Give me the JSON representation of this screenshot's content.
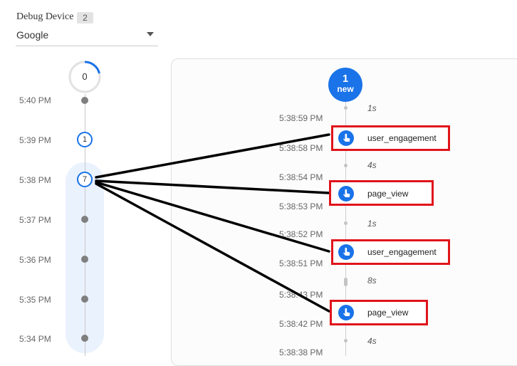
{
  "device": {
    "title": "Debug Device",
    "count": "2",
    "selected": "Google"
  },
  "minutes": {
    "counter": "0",
    "items": [
      {
        "time": "5:40 PM"
      },
      {
        "time": "5:39 PM",
        "count": "1"
      },
      {
        "time": "5:38 PM",
        "count": "7"
      },
      {
        "time": "5:37 PM"
      },
      {
        "time": "5:36 PM"
      },
      {
        "time": "5:35 PM"
      },
      {
        "time": "5:34 PM"
      }
    ]
  },
  "stream": {
    "new_count": "1",
    "new_label": "new",
    "gaps": [
      "1s",
      "4s",
      "1s",
      "8s",
      "4s"
    ],
    "timestamps": [
      "5:38:59 PM",
      "5:38:58 PM",
      "5:38:54 PM",
      "5:38:53 PM",
      "5:38:52 PM",
      "5:38:51 PM",
      "5:38:43 PM",
      "5:38:42 PM",
      "5:38:38 PM"
    ],
    "events": [
      {
        "name": "user_engagement"
      },
      {
        "name": "page_view"
      },
      {
        "name": "user_engagement"
      },
      {
        "name": "page_view"
      }
    ]
  },
  "colors": {
    "accent": "#1a73e8",
    "highlight_box": "#e0141b",
    "band": "#eaf2fe"
  }
}
